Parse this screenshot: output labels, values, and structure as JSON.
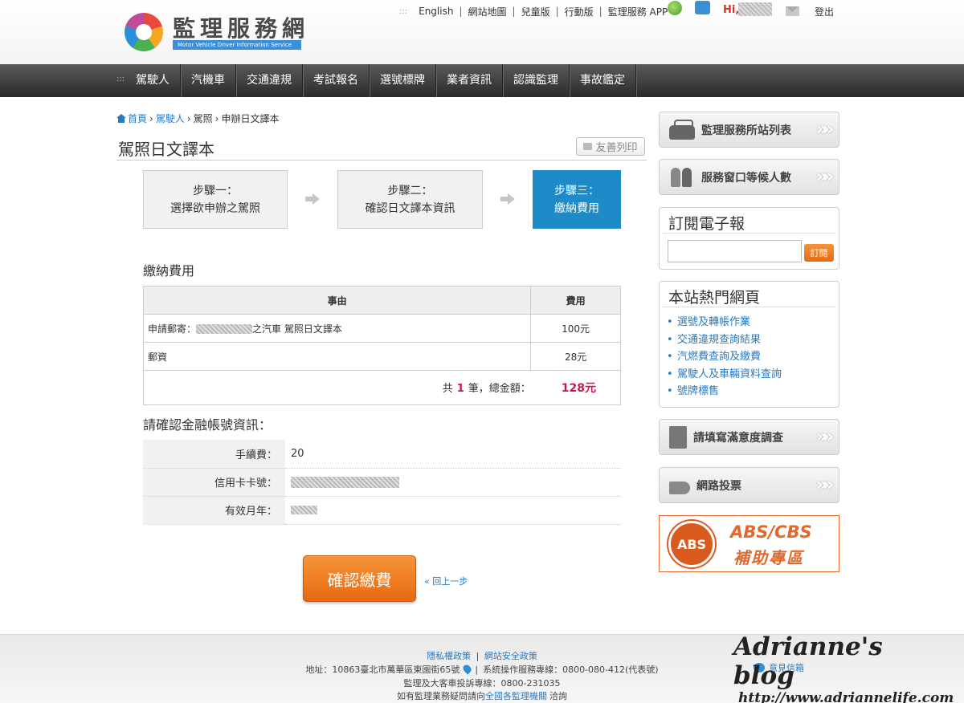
{
  "header": {
    "site_name": "監理服務網",
    "site_subtitle": "Motor Vehicle Driver Information Service",
    "top_links": [
      "English",
      "網站地圖",
      "兒童版",
      "行動版",
      "監理服務 APP"
    ],
    "greeting": "Hi,",
    "logout": "登出"
  },
  "nav": {
    "items": [
      "駕駛人",
      "汽機車",
      "交通違規",
      "考試報名",
      "選號標牌",
      "業者資訊",
      "認識監理",
      "事故鑑定"
    ]
  },
  "breadcrumb": {
    "home": "首頁",
    "level1": "駕駛人",
    "level2": "駕照",
    "current": "申辦日文譯本",
    "sep": "›"
  },
  "page": {
    "title": "駕照日文譯本",
    "print_label": "友善列印"
  },
  "steps": [
    {
      "label": "步驟一：",
      "desc": "選擇欲申辦之駕照"
    },
    {
      "label": "步驟二：",
      "desc": "確認日文譯本資訊"
    },
    {
      "label": "步驟三：",
      "desc": "繳納費用"
    }
  ],
  "fee": {
    "section_title": "繳納費用",
    "col_reason": "事由",
    "col_fee": "費用",
    "rows": [
      {
        "reason_prefix": "申請郵寄：",
        "reason_suffix": "之汽車 駕照日文譯本",
        "amount": "100元"
      },
      {
        "reason_prefix": "郵資",
        "reason_suffix": "",
        "amount": "28元"
      }
    ],
    "total_prefix": "共",
    "total_count": "1",
    "total_middle": "筆，總金額：",
    "total_amount": "128元"
  },
  "account": {
    "section_title": "請確認金融帳號資訊：",
    "rows": [
      {
        "label": "手續費：",
        "value": "20"
      },
      {
        "label": "信用卡卡號：",
        "value": ""
      },
      {
        "label": "有效月年：",
        "value": ""
      }
    ]
  },
  "actions": {
    "confirm": "確認繳費",
    "back": "« 回上一步"
  },
  "sidebar": {
    "station_list": "監理服務所站列表",
    "queue": "服務窗口等候人數",
    "newsletter_title": "訂閱電子報",
    "newsletter_placeholder": "",
    "subscribe": "訂閱",
    "hot_title": "本站熱門網頁",
    "hot_links": [
      "選號及轉帳作業",
      "交通違規查詢結果",
      "汽燃費查詢及繳費",
      "駕駛人及車輛資料查詢",
      "號牌標售"
    ],
    "survey": "請填寫滿意度調查",
    "vote": "網路投票",
    "abs_circle": "ABS",
    "abs_line1": "ABS/CBS",
    "abs_line2": "補助專區",
    "chevron": "»»"
  },
  "footer": {
    "privacy": "隱私權政策",
    "security": "網站安全政策",
    "address": "地址：10863臺北市萬華區東園街65號",
    "hotline": "系統操作服務專線：0800-080-412(代表號)",
    "complaint": "監理及大客車投訴專線：0800-231035",
    "inquiry_prefix": "如有監理業務疑問請向",
    "inquiry_link": "全國各監理機關",
    "inquiry_suffix": "洽詢",
    "feedback": "意見信箱"
  },
  "watermark": {
    "title": "Adrianne's blog",
    "url": "http://www.adriannelife.com"
  }
}
